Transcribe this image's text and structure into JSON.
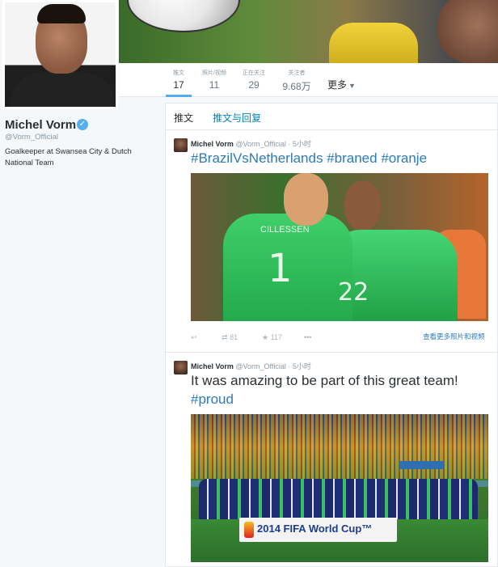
{
  "profile": {
    "name": "Michel Vorm",
    "handle": "@Vorm_Official",
    "bio": "Goalkeeper at Swansea City & Dutch National Team",
    "verified_glyph": "✓"
  },
  "stats": [
    {
      "label": "推文",
      "value": "17"
    },
    {
      "label": "照片/视频",
      "value": "11"
    },
    {
      "label": "正在关注",
      "value": "29"
    },
    {
      "label": "关注者",
      "value": "9.68万"
    }
  ],
  "more_label": "更多",
  "more_icon": "chevron-down-icon",
  "tabs": {
    "tweets": "推文",
    "tweets_replies": "推文与回复"
  },
  "tweets": [
    {
      "name": "Michel Vorm",
      "handle": "@Vorm_Official",
      "time": "· 5小时",
      "hashtags": [
        "#BrazilVsNetherlands",
        "#braned",
        "#oranje"
      ],
      "media": {
        "shirt_name": "CILLESSEN",
        "number_1": "1",
        "number_2": "22"
      },
      "actions": {
        "reply_icon": "reply-icon",
        "retweet_icon": "retweet-icon",
        "retweets": "81",
        "favorite_icon": "star-icon",
        "favorites": "117",
        "more_icon": "ellipsis-icon"
      },
      "view_more": "查看更多照片和视频"
    },
    {
      "name": "Michel Vorm",
      "handle": "@Vorm_Official",
      "time": "· 5小时",
      "text": "It was amazing to be part of this great team!",
      "hashtag": "#proud",
      "media": {
        "banner_text": "2014 FIFA World Cup™"
      }
    }
  ],
  "colors": {
    "link": "#2b7bb9",
    "accent": "#55acee",
    "muted": "#8899a6"
  }
}
